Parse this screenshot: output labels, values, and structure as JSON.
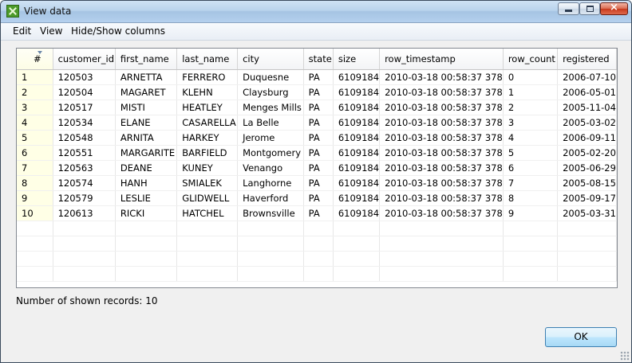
{
  "window": {
    "title": "View data"
  },
  "menu": [
    "Edit",
    "View",
    "Hide/Show columns"
  ],
  "table": {
    "columns": [
      "#",
      "customer_id",
      "first_name",
      "last_name",
      "city",
      "state",
      "size",
      "row_timestamp",
      "row_count",
      "registered"
    ],
    "rows": [
      [
        "1",
        "120503",
        "ARNETTA",
        "FERRERO",
        "Duquesne",
        "PA",
        "6109184",
        "2010-03-18 00:58:37 378",
        "0",
        "2006-07-10"
      ],
      [
        "2",
        "120504",
        "MAGARET",
        "KLEHN",
        "Claysburg",
        "PA",
        "6109184",
        "2010-03-18 00:58:37 378",
        "1",
        "2006-05-01"
      ],
      [
        "3",
        "120517",
        "MISTI",
        "HEATLEY",
        "Menges Mills",
        "PA",
        "6109184",
        "2010-03-18 00:58:37 378",
        "2",
        "2005-11-04"
      ],
      [
        "4",
        "120534",
        "ELANE",
        "CASARELLA",
        "La Belle",
        "PA",
        "6109184",
        "2010-03-18 00:58:37 378",
        "3",
        "2005-03-02"
      ],
      [
        "5",
        "120548",
        "ARNITA",
        "HARKEY",
        "Jerome",
        "PA",
        "6109184",
        "2010-03-18 00:58:37 378",
        "4",
        "2006-09-11"
      ],
      [
        "6",
        "120551",
        "MARGARITE",
        "BARFIELD",
        "Montgomery",
        "PA",
        "6109184",
        "2010-03-18 00:58:37 378",
        "5",
        "2005-02-20"
      ],
      [
        "7",
        "120563",
        "DEANE",
        "KUNEY",
        "Venango",
        "PA",
        "6109184",
        "2010-03-18 00:58:37 378",
        "6",
        "2005-06-29"
      ],
      [
        "8",
        "120574",
        "HANH",
        "SMIALEK",
        "Langhorne",
        "PA",
        "6109184",
        "2010-03-18 00:58:37 378",
        "7",
        "2005-08-15"
      ],
      [
        "9",
        "120579",
        "LESLIE",
        "GLIDWELL",
        "Haverford",
        "PA",
        "6109184",
        "2010-03-18 00:58:37 378",
        "8",
        "2005-09-17"
      ],
      [
        "10",
        "120613",
        "RICKI",
        "HATCHEL",
        "Brownsville",
        "PA",
        "6109184",
        "2010-03-18 00:58:37 378",
        "9",
        "2005-03-31"
      ]
    ]
  },
  "status": {
    "text": "Number of shown records: 10"
  },
  "buttons": {
    "ok": "OK"
  }
}
